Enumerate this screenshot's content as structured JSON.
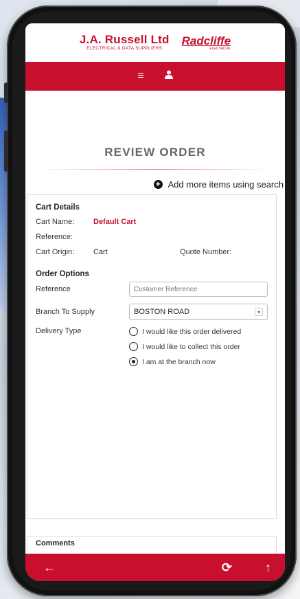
{
  "brand": {
    "jar_name": "J.A. Russell Ltd",
    "jar_sub": "ELECTRICAL & DATA SUPPLIERS",
    "rad_name": "Radcliffe",
    "rad_sub": "ELECTRICAL",
    "accent": "#c8102e"
  },
  "nav": {
    "menu_icon": "≡",
    "user_icon": "👤"
  },
  "page": {
    "title": "REVIEW ORDER",
    "add_items": "Add more items using search"
  },
  "cart": {
    "heading": "Cart Details",
    "name_label": "Cart Name:",
    "name_value": "Default Cart",
    "reference_label": "Reference:",
    "origin_label": "Cart Origin:",
    "origin_value": "Cart",
    "quote_label": "Quote Number:"
  },
  "options": {
    "heading": "Order Options",
    "reference_label": "Reference",
    "reference_placeholder": "Customer Reference",
    "branch_label": "Branch To Supply",
    "branch_value": "BOSTON ROAD",
    "delivery_label": "Delivery Type",
    "delivery_options": [
      {
        "label": "I would like this order delivered",
        "selected": false
      },
      {
        "label": "I would like to collect this order",
        "selected": false
      },
      {
        "label": "I am at the branch now",
        "selected": true
      }
    ]
  },
  "comments": {
    "heading": "Comments"
  },
  "footer": {
    "back_icon": "←",
    "refresh_icon": "⟳",
    "up_icon": "↑"
  }
}
